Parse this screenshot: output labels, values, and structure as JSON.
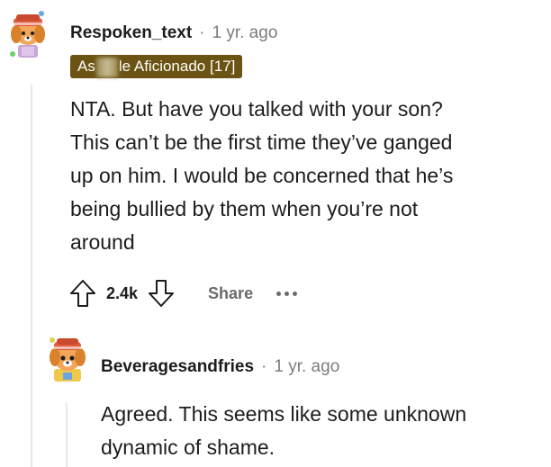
{
  "comment1": {
    "username": "Respoken_text",
    "separator": "·",
    "age": "1 yr. ago",
    "flair_prefix": "As",
    "flair_suffix": "le Aficionado [17]",
    "body": "NTA. But have you talked with your son? This can’t be the first time they’ve ganged up on him. I would be concerned that he’s being bullied by them when you’re not around",
    "body_lines": [
      "NTA. But have you talked with your son?",
      "This can’t be the first time they’ve ganged",
      "up on him. I would be concerned that he’s",
      "being bullied by them when you’re not",
      "around"
    ],
    "votes": "2.4k",
    "share_label": "Share"
  },
  "comment2": {
    "username": "Beveragesandfries",
    "separator": "·",
    "age": "1 yr. ago",
    "body_lines": [
      "Agreed. This seems like some unknown",
      "dynamic of shame."
    ]
  },
  "icons": {
    "upvote": "arrow-up-icon",
    "downvote": "arrow-down-icon",
    "more": "more-horizontal-icon"
  }
}
